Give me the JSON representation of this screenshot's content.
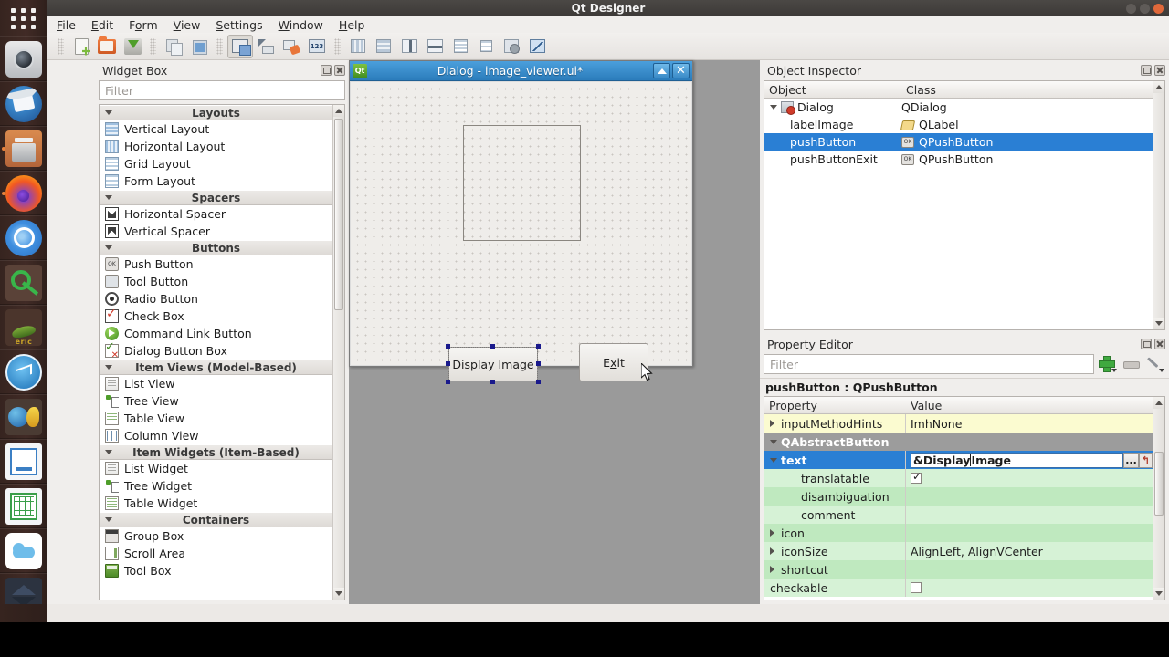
{
  "window": {
    "title": "Qt Designer"
  },
  "menubar": {
    "items": [
      "File",
      "Edit",
      "Form",
      "View",
      "Settings",
      "Window",
      "Help"
    ]
  },
  "toolbar": {
    "file_group": [
      "new-form-icon",
      "open-form-icon",
      "save-form-icon"
    ],
    "edit_group": [
      "copy-icon",
      "paste-icon"
    ],
    "mode_group": [
      "edit-widgets-icon",
      "edit-signals-slots-icon",
      "edit-buddies-icon",
      "edit-tab-order-icon"
    ],
    "layout_group": [
      "layout-horizontally-icon",
      "layout-vertically-icon",
      "layout-splitter-horizontal-icon",
      "layout-splitter-vertical-icon",
      "layout-grid-icon",
      "layout-form-icon",
      "break-layout-icon",
      "adjust-size-icon"
    ]
  },
  "widget_box": {
    "title": "Widget Box",
    "filter_placeholder": "Filter",
    "filter_value": "",
    "categories": [
      {
        "name": "Layouts",
        "items": [
          {
            "label": "Vertical Layout",
            "icon": "vertical-layout-icon"
          },
          {
            "label": "Horizontal Layout",
            "icon": "horizontal-layout-icon"
          },
          {
            "label": "Grid Layout",
            "icon": "grid-layout-icon"
          },
          {
            "label": "Form Layout",
            "icon": "form-layout-icon"
          }
        ]
      },
      {
        "name": "Spacers",
        "items": [
          {
            "label": "Horizontal Spacer",
            "icon": "horizontal-spacer-icon"
          },
          {
            "label": "Vertical Spacer",
            "icon": "vertical-spacer-icon"
          }
        ]
      },
      {
        "name": "Buttons",
        "items": [
          {
            "label": "Push Button",
            "icon": "push-button-icon"
          },
          {
            "label": "Tool Button",
            "icon": "tool-button-icon"
          },
          {
            "label": "Radio Button",
            "icon": "radio-button-icon"
          },
          {
            "label": "Check Box",
            "icon": "check-box-icon"
          },
          {
            "label": "Command Link Button",
            "icon": "command-link-button-icon"
          },
          {
            "label": "Dialog Button Box",
            "icon": "dialog-button-box-icon"
          }
        ]
      },
      {
        "name": "Item Views (Model-Based)",
        "items": [
          {
            "label": "List View",
            "icon": "list-view-icon"
          },
          {
            "label": "Tree View",
            "icon": "tree-view-icon"
          },
          {
            "label": "Table View",
            "icon": "table-view-icon"
          },
          {
            "label": "Column View",
            "icon": "column-view-icon"
          }
        ]
      },
      {
        "name": "Item Widgets (Item-Based)",
        "items": [
          {
            "label": "List Widget",
            "icon": "list-widget-icon"
          },
          {
            "label": "Tree Widget",
            "icon": "tree-widget-icon"
          },
          {
            "label": "Table Widget",
            "icon": "table-widget-icon"
          }
        ]
      },
      {
        "name": "Containers",
        "items": [
          {
            "label": "Group Box",
            "icon": "group-box-icon"
          },
          {
            "label": "Scroll Area",
            "icon": "scroll-area-icon"
          },
          {
            "label": "Tool Box",
            "icon": "tool-box-icon"
          }
        ]
      }
    ]
  },
  "form_window": {
    "title": "Dialog - image_viewer.ui*",
    "buttons": [
      {
        "name": "display-image-button",
        "label": "Display Image",
        "mnemonic": "D",
        "selected": true
      },
      {
        "name": "exit-button",
        "label": "Exit",
        "mnemonic": "x",
        "selected": false
      }
    ],
    "label_image": {
      "name": "labelImage",
      "text": ""
    },
    "titlebar_buttons": [
      "restore-icon",
      "close-icon"
    ]
  },
  "object_inspector": {
    "title": "Object Inspector",
    "columns": [
      "Object",
      "Class"
    ],
    "rows": [
      {
        "object": "Dialog",
        "class": "QDialog",
        "indent": 0,
        "icon": "dialog-icon",
        "expanded": true,
        "selected": false
      },
      {
        "object": "labelImage",
        "class": "QLabel",
        "indent": 1,
        "icon": "label-icon",
        "selected": false
      },
      {
        "object": "pushButton",
        "class": "QPushButton",
        "indent": 1,
        "icon": "push-button-icon",
        "selected": true
      },
      {
        "object": "pushButtonExit",
        "class": "QPushButton",
        "indent": 1,
        "icon": "push-button-icon",
        "selected": false
      }
    ]
  },
  "property_editor": {
    "title": "Property Editor",
    "filter_placeholder": "Filter",
    "filter_value": "",
    "object_line": "pushButton : QPushButton",
    "columns": [
      "Property",
      "Value"
    ],
    "rows": [
      {
        "property": "inputMethodHints",
        "value": "ImhNone",
        "style": "yellow",
        "indent": 0,
        "expander": "right"
      },
      {
        "property": "QAbstractButton",
        "value": "",
        "style": "group",
        "indent": 0,
        "expander": "down"
      },
      {
        "property": "text",
        "value": "&Display Image",
        "style": "selected",
        "indent": 0,
        "expander": "down",
        "editing": true,
        "value_before_caret": "&Display",
        "value_after_caret": " Image"
      },
      {
        "property": "translatable",
        "value": "",
        "style": "green-light",
        "indent": 2,
        "checkbox": true,
        "checked": true
      },
      {
        "property": "disambiguation",
        "value": "",
        "style": "green-dark",
        "indent": 2
      },
      {
        "property": "comment",
        "value": "",
        "style": "green-light",
        "indent": 2
      },
      {
        "property": "icon",
        "value": "",
        "style": "green-dark",
        "indent": 0,
        "expander": "right"
      },
      {
        "property": "iconSize",
        "value": "AlignLeft, AlignVCenter",
        "style": "green-light",
        "indent": 0,
        "expander": "right"
      },
      {
        "property": "shortcut",
        "value": "",
        "style": "green-dark",
        "indent": 0,
        "expander": "right"
      },
      {
        "property": "checkable",
        "value": "",
        "style": "green-light",
        "indent": 0,
        "checkbox": true,
        "checked": false
      }
    ],
    "edit_buttons": {
      "dots": "...",
      "reset": "↰"
    },
    "toolbar_icons": [
      "add-property-icon",
      "remove-property-icon",
      "configure-icon"
    ]
  },
  "launcher": {
    "items": [
      {
        "name": "dash-home-icon"
      },
      {
        "name": "camera-icon"
      },
      {
        "name": "mail-icon"
      },
      {
        "name": "files-icon",
        "running": true
      },
      {
        "name": "firefox-icon",
        "running": true
      },
      {
        "name": "chromium-icon"
      },
      {
        "name": "keys-icon"
      },
      {
        "name": "eric-ide-icon",
        "label": "eric"
      },
      {
        "name": "monitor-icon"
      },
      {
        "name": "seamonkey-icon"
      },
      {
        "name": "libreoffice-impress-icon"
      },
      {
        "name": "libreoffice-calc-icon"
      },
      {
        "name": "cloud-icon"
      },
      {
        "name": "virtualbox-icon"
      }
    ]
  },
  "colors": {
    "selection_blue": "#2a7fd4",
    "titlebar_blue": "#2b7cbb",
    "property_yellow": "#fbfbd0",
    "property_green": "#d6f2d6",
    "panel_bg": "#f0eeec"
  }
}
